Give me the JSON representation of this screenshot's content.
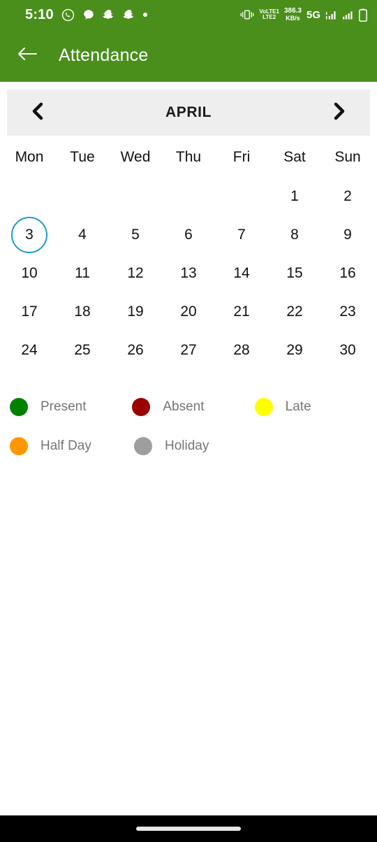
{
  "status_bar": {
    "time": "5:10",
    "left_icons": [
      "whatsapp-icon",
      "message-icon",
      "snapchat-icon",
      "snapchat-icon",
      "dot-icon"
    ],
    "vibrate_icon": "vibrate-icon",
    "volte_line1": "VoLTE1",
    "volte_line2": "LTE2",
    "net_speed_value": "386.3",
    "net_speed_unit": "KB/s",
    "network_type": "5G",
    "signal_icons": [
      "signal-bars-icon",
      "signal-bars-icon"
    ],
    "battery_icon": "battery-icon"
  },
  "app_bar": {
    "back_icon": "back-arrow-icon",
    "title": "Attendance",
    "background_color": "#4a8f1c"
  },
  "month_nav": {
    "prev_icon": "chevron-left-icon",
    "month_label": "APRIL",
    "next_icon": "chevron-right-icon",
    "background_color": "#eeeeee"
  },
  "calendar": {
    "weekdays": [
      "Mon",
      "Tue",
      "Wed",
      "Thu",
      "Fri",
      "Sat",
      "Sun"
    ],
    "leading_blanks": 5,
    "days": [
      1,
      2,
      3,
      4,
      5,
      6,
      7,
      8,
      9,
      10,
      11,
      12,
      13,
      14,
      15,
      16,
      17,
      18,
      19,
      20,
      21,
      22,
      23,
      24,
      25,
      26,
      27,
      28,
      29,
      30
    ],
    "selected_day": 3,
    "selected_ring_color": "#1e9cc4"
  },
  "legend": {
    "rows": [
      [
        {
          "label": "Present",
          "color": "#008000",
          "name": "legend-present"
        },
        {
          "label": "Absent",
          "color": "#9b0000",
          "name": "legend-absent"
        },
        {
          "label": "Late",
          "color": "#ffff00",
          "name": "legend-late"
        }
      ],
      [
        {
          "label": "Half Day",
          "color": "#ff9800",
          "name": "legend-half-day"
        },
        {
          "label": "Holiday",
          "color": "#9e9e9e",
          "name": "legend-holiday"
        }
      ]
    ]
  },
  "nav_bar": {
    "home_indicator": "home-indicator"
  }
}
